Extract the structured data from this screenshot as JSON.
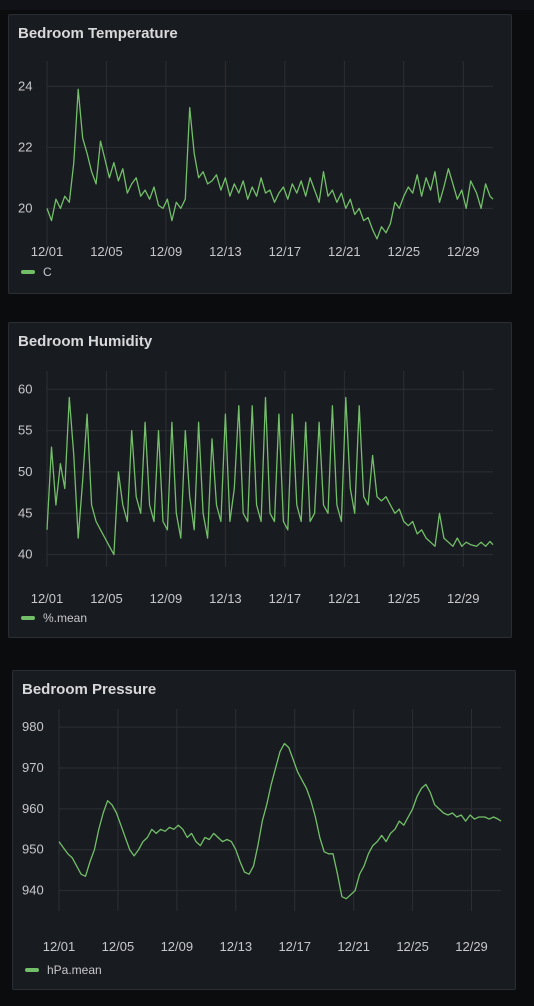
{
  "colors": {
    "series": "#73bf69",
    "grid": "#2c2f35",
    "panel": "#181b1f",
    "text": "#c7c8cc"
  },
  "panels": [
    {
      "title": "Bedroom Temperature",
      "legend": "C"
    },
    {
      "title": "Bedroom Humidity",
      "legend": "%.mean"
    },
    {
      "title": "Bedroom Pressure",
      "legend": "hPa.mean"
    }
  ],
  "chart_data": [
    {
      "type": "line",
      "title": "Bedroom Temperature",
      "x_ticks": [
        "12/01",
        "12/05",
        "12/09",
        "12/13",
        "12/17",
        "12/21",
        "12/25",
        "12/29"
      ],
      "x_range_days": [
        0,
        30
      ],
      "ylim": [
        18.8,
        24.5
      ],
      "y_ticks": [
        20,
        22,
        24
      ],
      "grid": true,
      "legend_position": "bottom-left",
      "series": [
        {
          "name": "C",
          "x": [
            0,
            0.3,
            0.6,
            0.9,
            1.2,
            1.5,
            1.8,
            2.1,
            2.4,
            2.7,
            3.0,
            3.3,
            3.6,
            3.9,
            4.2,
            4.5,
            4.8,
            5.1,
            5.4,
            5.7,
            6.0,
            6.3,
            6.6,
            6.9,
            7.2,
            7.5,
            7.8,
            8.1,
            8.4,
            8.7,
            9.0,
            9.3,
            9.6,
            9.9,
            10.2,
            10.5,
            10.8,
            11.1,
            11.4,
            11.7,
            12.0,
            12.3,
            12.6,
            12.9,
            13.2,
            13.5,
            13.8,
            14.1,
            14.4,
            14.7,
            15.0,
            15.3,
            15.6,
            15.9,
            16.2,
            16.5,
            16.8,
            17.1,
            17.4,
            17.7,
            18.0,
            18.3,
            18.6,
            18.9,
            19.2,
            19.5,
            19.8,
            20.1,
            20.4,
            20.7,
            21.0,
            21.3,
            21.6,
            21.9,
            22.2,
            22.5,
            22.8,
            23.1,
            23.4,
            23.7,
            24.0,
            24.3,
            24.6,
            24.9,
            25.2,
            25.5,
            25.8,
            26.1,
            26.4,
            26.7,
            27.0,
            27.3,
            27.6,
            27.9,
            28.2,
            28.5,
            28.9,
            29.2,
            29.5,
            29.8,
            30.0
          ],
          "y": [
            20.0,
            19.6,
            20.3,
            20.0,
            20.4,
            20.2,
            21.5,
            23.9,
            22.3,
            21.8,
            21.2,
            20.8,
            22.2,
            21.6,
            21.0,
            21.5,
            20.9,
            21.3,
            20.5,
            20.8,
            21.0,
            20.4,
            20.6,
            20.3,
            20.7,
            20.1,
            20.0,
            20.3,
            19.6,
            20.2,
            20.0,
            20.3,
            23.3,
            21.8,
            21.0,
            21.2,
            20.8,
            20.9,
            21.1,
            20.6,
            21.0,
            20.4,
            20.8,
            20.5,
            20.9,
            20.3,
            20.7,
            20.4,
            21.0,
            20.5,
            20.6,
            20.2,
            20.5,
            20.7,
            20.3,
            20.8,
            20.5,
            20.9,
            20.4,
            21.0,
            20.6,
            20.2,
            21.2,
            20.4,
            20.6,
            20.2,
            20.5,
            20.0,
            20.3,
            19.8,
            20.0,
            19.6,
            19.7,
            19.3,
            19.0,
            19.4,
            19.2,
            19.5,
            20.2,
            20.0,
            20.4,
            20.7,
            20.5,
            21.1,
            20.4,
            21.0,
            20.6,
            21.2,
            20.2,
            20.7,
            21.3,
            20.8,
            20.3,
            20.6,
            20.0,
            20.9,
            20.5,
            20.0,
            20.8,
            20.4,
            20.3
          ]
        }
      ]
    },
    {
      "type": "line",
      "title": "Bedroom Humidity",
      "x_ticks": [
        "12/01",
        "12/05",
        "12/09",
        "12/13",
        "12/17",
        "12/21",
        "12/25",
        "12/29"
      ],
      "x_range_days": [
        0,
        30
      ],
      "ylim": [
        38.5,
        61
      ],
      "y_ticks": [
        40,
        45,
        50,
        55,
        60
      ],
      "grid": true,
      "legend_position": "bottom-left",
      "series": [
        {
          "name": "%.mean",
          "x": [
            0,
            0.3,
            0.6,
            0.9,
            1.2,
            1.5,
            1.8,
            2.1,
            2.4,
            2.7,
            3.0,
            3.3,
            3.6,
            3.9,
            4.2,
            4.5,
            4.8,
            5.1,
            5.4,
            5.7,
            6.0,
            6.3,
            6.6,
            6.9,
            7.2,
            7.5,
            7.8,
            8.1,
            8.4,
            8.7,
            9.0,
            9.3,
            9.6,
            9.9,
            10.2,
            10.5,
            10.8,
            11.1,
            11.4,
            11.7,
            12.0,
            12.3,
            12.6,
            12.9,
            13.2,
            13.5,
            13.8,
            14.1,
            14.4,
            14.7,
            15.0,
            15.3,
            15.6,
            15.9,
            16.2,
            16.5,
            16.8,
            17.1,
            17.4,
            17.7,
            18.0,
            18.3,
            18.6,
            18.9,
            19.2,
            19.5,
            19.8,
            20.1,
            20.4,
            20.7,
            21.0,
            21.3,
            21.6,
            21.9,
            22.2,
            22.5,
            22.8,
            23.1,
            23.4,
            23.7,
            24.0,
            24.3,
            24.6,
            24.9,
            25.2,
            25.5,
            25.8,
            26.1,
            26.4,
            26.7,
            27.0,
            27.3,
            27.6,
            27.9,
            28.2,
            28.5,
            28.9,
            29.2,
            29.5,
            29.8,
            30.0
          ],
          "y": [
            43,
            53,
            46,
            51,
            48,
            59,
            52,
            42,
            49,
            57,
            46,
            44,
            43,
            42,
            41,
            40,
            50,
            46,
            44,
            55,
            47,
            45,
            56,
            46,
            44,
            55,
            44,
            43,
            56,
            45,
            42,
            55,
            47,
            43,
            56,
            45,
            42,
            54,
            46,
            44,
            57,
            44,
            48,
            58,
            45,
            44,
            58,
            46,
            44,
            59,
            45,
            44,
            57,
            44,
            43,
            57,
            46,
            44,
            56,
            44,
            45,
            56,
            46,
            45,
            58,
            46,
            44,
            59,
            48,
            45,
            58,
            47,
            46,
            52,
            47,
            46.5,
            47,
            46,
            45,
            45.5,
            44,
            43.5,
            44,
            42.5,
            43,
            42,
            41.5,
            41,
            45,
            42,
            41.5,
            41,
            42,
            41,
            41.5,
            41.2,
            41,
            41.5,
            41,
            41.6,
            41.2
          ]
        }
      ]
    },
    {
      "type": "line",
      "title": "Bedroom Pressure",
      "x_ticks": [
        "12/01",
        "12/05",
        "12/09",
        "12/13",
        "12/17",
        "12/21",
        "12/25",
        "12/29"
      ],
      "x_range_days": [
        0,
        30
      ],
      "ylim": [
        935,
        982
      ],
      "y_ticks": [
        940,
        950,
        960,
        970,
        980
      ],
      "grid": true,
      "legend_position": "bottom-left",
      "series": [
        {
          "name": "hPa.mean",
          "x": [
            0,
            0.3,
            0.6,
            0.9,
            1.2,
            1.5,
            1.8,
            2.1,
            2.4,
            2.7,
            3.0,
            3.3,
            3.6,
            3.9,
            4.2,
            4.5,
            4.8,
            5.1,
            5.4,
            5.7,
            6.0,
            6.3,
            6.6,
            6.9,
            7.2,
            7.5,
            7.8,
            8.1,
            8.4,
            8.7,
            9.0,
            9.3,
            9.6,
            9.9,
            10.2,
            10.5,
            10.8,
            11.1,
            11.4,
            11.7,
            12.0,
            12.3,
            12.6,
            12.9,
            13.2,
            13.5,
            13.8,
            14.1,
            14.4,
            14.7,
            15.0,
            15.3,
            15.6,
            15.9,
            16.2,
            16.5,
            16.8,
            17.1,
            17.4,
            17.7,
            18.0,
            18.3,
            18.6,
            18.9,
            19.2,
            19.5,
            19.8,
            20.1,
            20.4,
            20.7,
            21.0,
            21.3,
            21.6,
            21.9,
            22.2,
            22.5,
            22.8,
            23.1,
            23.4,
            23.7,
            24.0,
            24.3,
            24.6,
            24.9,
            25.2,
            25.5,
            25.8,
            26.1,
            26.4,
            26.7,
            27.0,
            27.3,
            27.6,
            27.9,
            28.2,
            28.5,
            28.9,
            29.2,
            29.5,
            29.8,
            30.0
          ],
          "y": [
            952,
            950.5,
            949,
            948,
            946,
            944,
            943.5,
            947,
            950,
            955,
            959,
            962,
            961,
            959,
            956,
            953,
            950,
            948.5,
            950,
            952,
            953,
            955,
            954,
            955,
            954.5,
            955.5,
            955,
            956,
            955,
            953,
            954,
            952,
            951,
            953,
            952.5,
            954,
            953,
            952,
            952.5,
            952,
            950,
            947,
            944.5,
            944,
            946,
            951,
            957,
            961,
            966,
            970,
            974,
            976,
            975,
            972,
            969,
            967,
            965,
            962,
            958,
            953,
            949.5,
            949,
            949,
            944,
            938.5,
            938,
            939,
            940,
            944,
            946,
            949,
            951,
            952,
            953.5,
            952,
            954,
            955,
            957,
            956,
            958,
            960,
            963,
            965,
            966,
            964,
            961,
            960,
            959,
            958.5,
            959,
            958,
            958.5,
            957,
            958.5,
            957.5,
            958,
            958,
            957.5,
            958,
            957.5,
            957
          ]
        }
      ]
    }
  ]
}
